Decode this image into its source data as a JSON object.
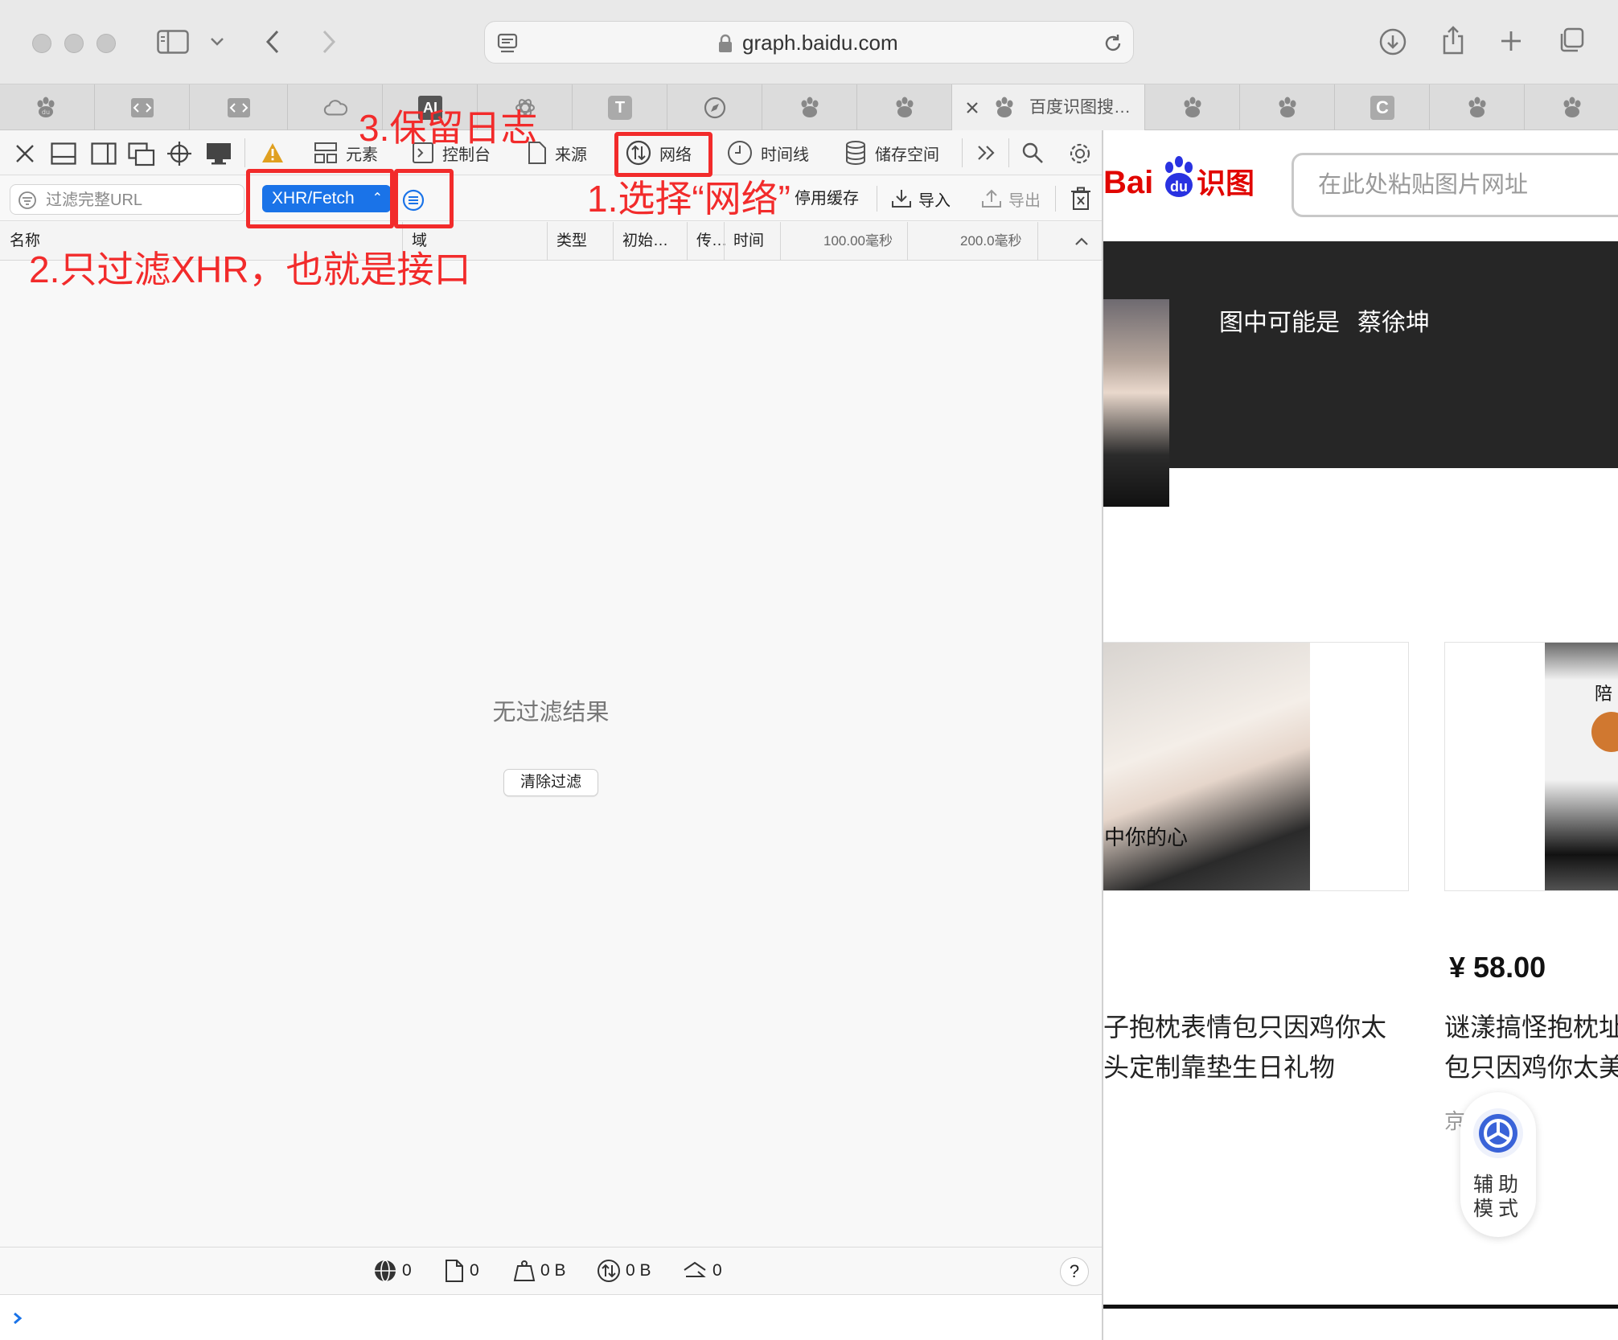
{
  "browser": {
    "url": "graph.baidu.com",
    "active_tab_title": "百度识图搜…",
    "tab_icons": [
      "baidu-paw-icon",
      "code-icon",
      "code-icon",
      "cloud-icon",
      "ai-icon",
      "openai-icon",
      "t-icon",
      "compass-icon",
      "baidu-paw-icon",
      "baidu-paw-icon",
      "baidu-paw-icon",
      "baidu-paw-icon",
      "baidu-paw-icon",
      "c-icon",
      "baidu-paw-icon",
      "baidu-paw-icon"
    ],
    "ai_tab_letters": "AI",
    "t_tab_letter": "T",
    "c_tab_letter": "C"
  },
  "devtools": {
    "tabs": {
      "elements": "元素",
      "console": "控制台",
      "sources": "来源",
      "network": "网络",
      "timelines": "时间线",
      "storage": "储存空间"
    },
    "filter_placeholder": "过滤完整URL",
    "type_filter": "XHR/Fetch",
    "disable_cache": "停用缓存",
    "import": "导入",
    "export": "导出",
    "columns": {
      "name": "名称",
      "domain": "域",
      "type": "类型",
      "initiator": "初始…",
      "transfer": "传…",
      "time": "时间",
      "tick_1": "100.00毫秒",
      "tick_2": "200.0毫秒"
    },
    "empty_message": "无过滤结果",
    "clear_filter": "清除过滤",
    "status": {
      "requests": "0",
      "resources": "0",
      "size": "0 B",
      "transferred": "0 B",
      "websockets": "0"
    },
    "help": "?"
  },
  "annotations": {
    "step1": "1.选择“网络”",
    "step2": "2.只过滤XHR，也就是接口",
    "step3": "3.保留日志",
    "color": "#f22b2b"
  },
  "page": {
    "logo_text_bai": "Bai",
    "logo_text_du": "du",
    "logo_text_shitu": "识图",
    "search_placeholder": "在此处粘贴图片网址",
    "result_label": "图中可能是",
    "result_name": "蔡徐坤",
    "card1_caption": "中你的心",
    "card2_caption": "陪",
    "price": "¥ 58.00",
    "product1_line1": "子抱枕表情包只因鸡你太",
    "product1_line2": "头定制靠垫生日礼物",
    "product2_line1": "谜漾搞怪抱枕址",
    "product2_line2": "包只因鸡你太美",
    "shop_char": "京",
    "assist_label": "辅助模式",
    "brand_red": "#e10601",
    "brand_blue": "#2932e1"
  }
}
